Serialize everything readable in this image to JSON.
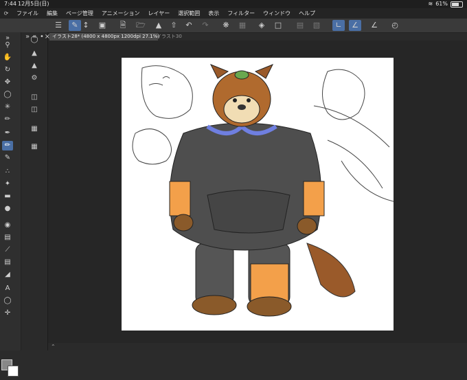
{
  "status": {
    "time": "7:44",
    "date": "12月5日(日)",
    "wifi_icon": "wifi-icon",
    "battery": "61%"
  },
  "menu": {
    "items": [
      "ファイル",
      "編集",
      "ページ管理",
      "アニメーション",
      "レイヤー",
      "選択範囲",
      "表示",
      "フィルター",
      "ウィンドウ",
      "ヘルプ"
    ]
  },
  "tabs": {
    "active": "イラスト28* (4800 x 4800px 1200dpi 27.1%)",
    "other": "イラスト30"
  },
  "toolbar_icons": [
    "menu-icon",
    "brush-tool-icon",
    "chevron-updown-icon",
    "quickmask-icon",
    "new-file-icon",
    "open-icon",
    "save-icon",
    "upload-icon",
    "undo-icon",
    "redo-icon",
    "loading-icon",
    "transform-icon",
    "fill-icon",
    "crop-icon",
    "clear-icon",
    "delete-icon",
    "stabilizer-a-icon",
    "stabilizer-b-icon",
    "ruler-icon",
    "pen-pressure-icon"
  ],
  "colors": {
    "accent": "#4a6fa5",
    "bg": "#2b2b2b",
    "paper": "#ffffff"
  }
}
